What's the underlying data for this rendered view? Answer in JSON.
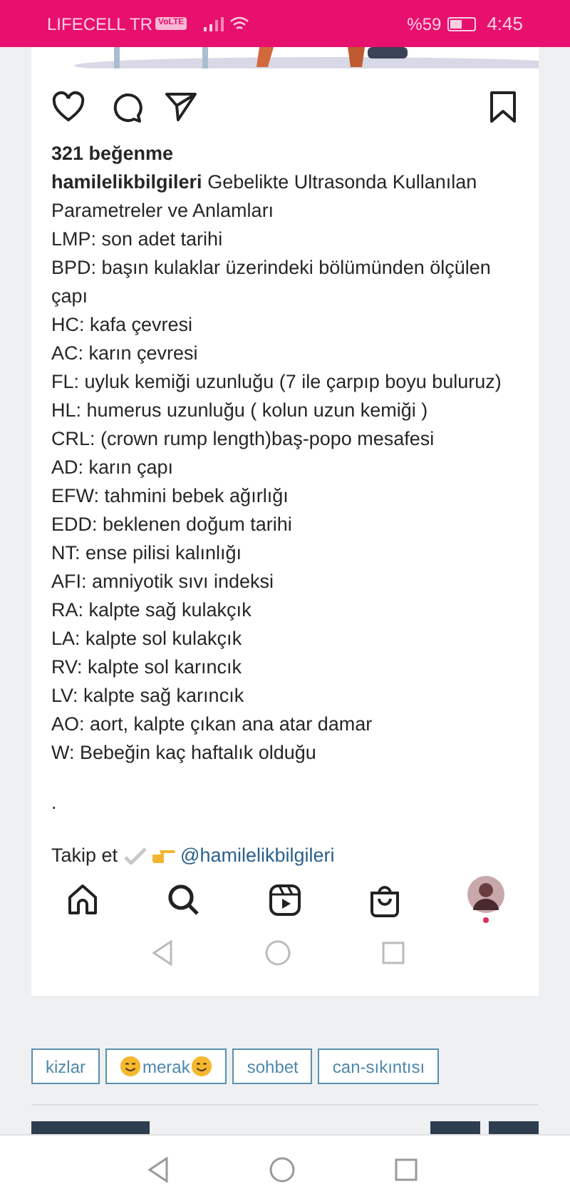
{
  "status_bar": {
    "carrier": "LIFECELL TR",
    "volte": "VoLTE",
    "battery_text": "%59",
    "time": "4:45"
  },
  "post": {
    "likes": "321 beğenme",
    "username": "hamilelikbilgileri",
    "title": "Gebelikte Ultrasonda Kullanılan Parametreler ve Anlamları",
    "lines": [
      "LMP: son adet tarihi",
      "BPD: başın kulaklar üzerindeki bölümünden ölçülen çapı",
      "HC: kafa çevresi",
      "AC: karın çevresi",
      "FL: uyluk kemiği uzunluğu (7 ile çarpıp boyu buluruz)",
      "HL: humerus uzunluğu ( kolun uzun kemiği )",
      "CRL: (crown rump length)baş-popo mesafesi",
      "AD: karın çapı",
      "EFW: tahmini bebek ağırlığı",
      "EDD: beklenen doğum tarihi",
      "NT: ense pilisi kalınlığı",
      "AFI: amniyotik sıvı indeksi",
      "RA: kalpte sağ kulakçık",
      "LA: kalpte sol kulakçık",
      "RV: kalpte sol karıncık",
      "LV: kalpte sağ karıncık",
      "AO: aort, kalpte çıkan ana atar damar",
      "W: Bebeğin kaç haftalık olduğu"
    ],
    "dot": ".",
    "follow_text": "Takip et",
    "follow_link": "@hamilelikbilgileri"
  },
  "tags": [
    {
      "label": "kizlar",
      "smiley": false
    },
    {
      "label": "merak",
      "smiley": true
    },
    {
      "label": "sohbet",
      "smiley": false
    },
    {
      "label": "can-sıkıntısı",
      "smiley": false
    }
  ]
}
